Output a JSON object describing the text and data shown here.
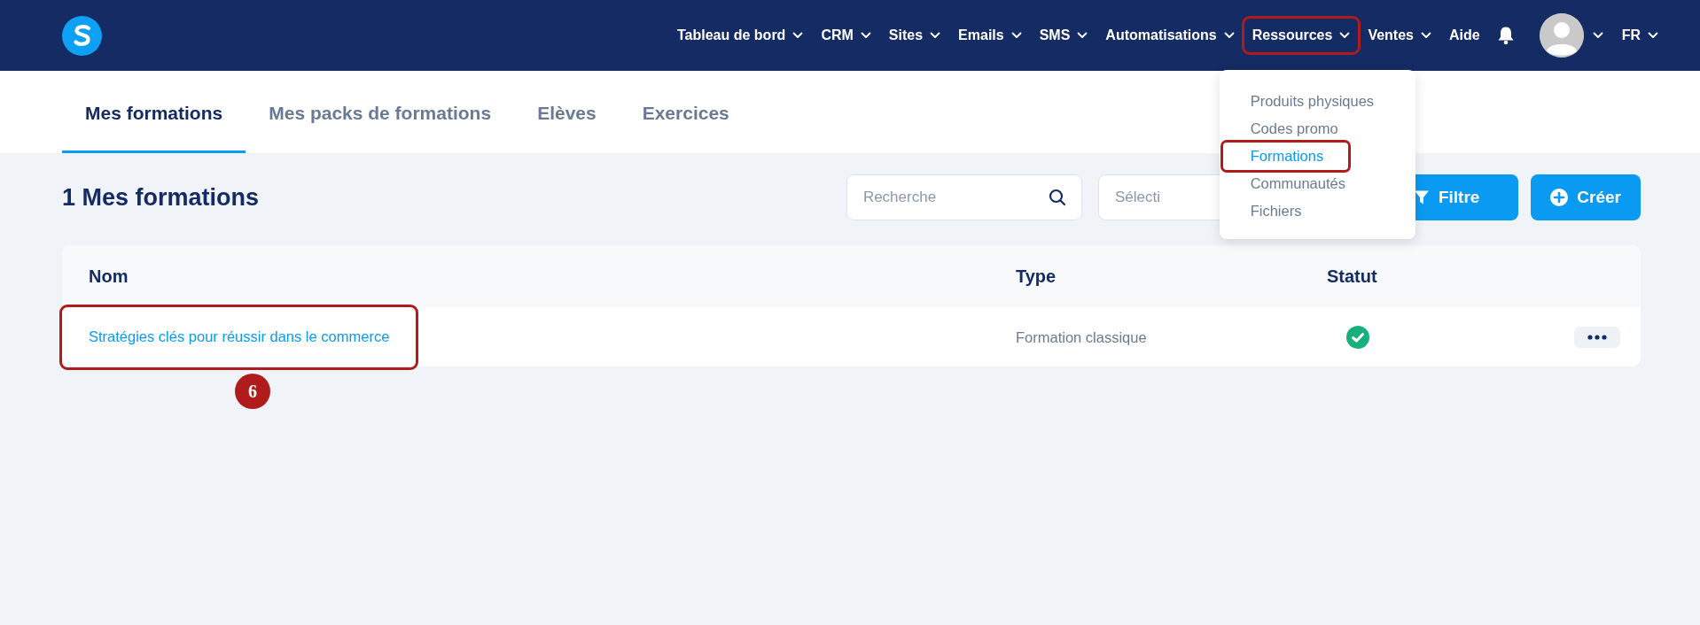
{
  "nav": {
    "items": [
      {
        "label": "Tableau de bord",
        "has_menu": true,
        "highlighted": false
      },
      {
        "label": "CRM",
        "has_menu": true,
        "highlighted": false
      },
      {
        "label": "Sites",
        "has_menu": true,
        "highlighted": false
      },
      {
        "label": "Emails",
        "has_menu": true,
        "highlighted": false
      },
      {
        "label": "SMS",
        "has_menu": true,
        "highlighted": false
      },
      {
        "label": "Automatisations",
        "has_menu": true,
        "highlighted": false
      },
      {
        "label": "Ressources",
        "has_menu": true,
        "highlighted": true,
        "menu": [
          {
            "label": "Produits physiques",
            "selected": false,
            "highlighted": false
          },
          {
            "label": "Codes promo",
            "selected": false,
            "highlighted": false
          },
          {
            "label": "Formations",
            "selected": true,
            "highlighted": true
          },
          {
            "label": "Communautés",
            "selected": false,
            "highlighted": false
          },
          {
            "label": "Fichiers",
            "selected": false,
            "highlighted": false
          }
        ]
      },
      {
        "label": "Ventes",
        "has_menu": true,
        "highlighted": false
      },
      {
        "label": "Aide",
        "has_menu": false,
        "highlighted": false
      }
    ],
    "language": "FR"
  },
  "tabs": [
    {
      "label": "Mes formations",
      "selected": true
    },
    {
      "label": "Mes packs de formations",
      "selected": false
    },
    {
      "label": "Elèves",
      "selected": false
    },
    {
      "label": "Exercices",
      "selected": false
    }
  ],
  "heading": "1 Mes formations",
  "search": {
    "placeholder": "Recherche"
  },
  "select": {
    "placeholder": "Sélecti"
  },
  "buttons": {
    "filter": "Filtre",
    "create": "Créer"
  },
  "table": {
    "columns": [
      "Nom",
      "Type",
      "Statut"
    ],
    "rows": [
      {
        "name": "Stratégies clés pour réussir dans le commerce",
        "type": "Formation classique",
        "active": true,
        "highlighted": true,
        "step_badge": "6"
      }
    ]
  }
}
